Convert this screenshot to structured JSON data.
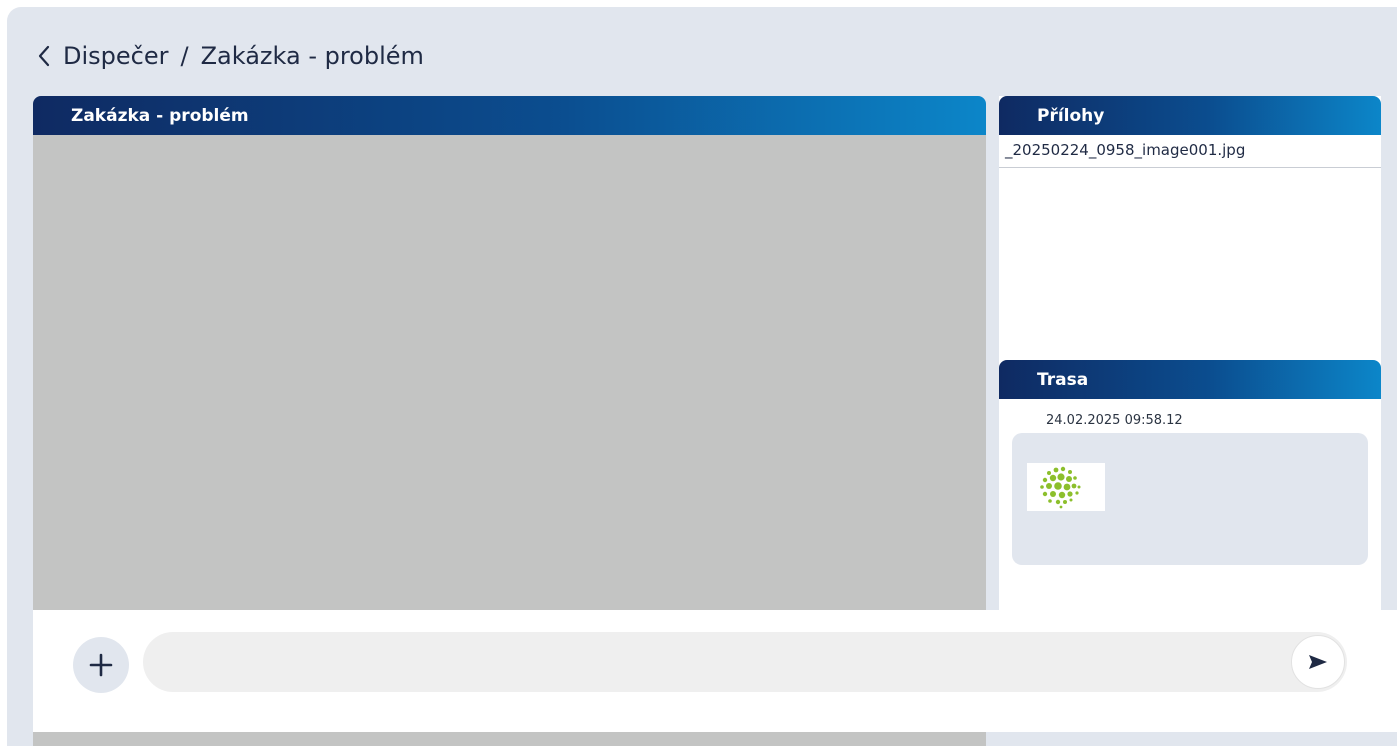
{
  "breadcrumb": {
    "parent": "Dispečer",
    "separator": "/",
    "current": "Zakázka - problém"
  },
  "main_panel": {
    "title": "Zakázka - problém"
  },
  "attachments": {
    "title": "Přílohy",
    "items": [
      "_20250224_0958_image001.jpg"
    ]
  },
  "route": {
    "title": "Trasa",
    "timestamp": "24.02.2025 09:58.12",
    "thumbnail_icon": "green-dotted-globe-logo"
  },
  "composer": {
    "placeholder": "",
    "add_icon": "plus-icon",
    "send_icon": "send-arrow-icon"
  },
  "colors": {
    "background": "#e1e6ee",
    "header_gradient_start": "#0f2a62",
    "header_gradient_end": "#0c86c9",
    "chat_area": "#c3c4c3",
    "text_dark": "#1f2a44",
    "logo_green": "#8cbf2c"
  }
}
